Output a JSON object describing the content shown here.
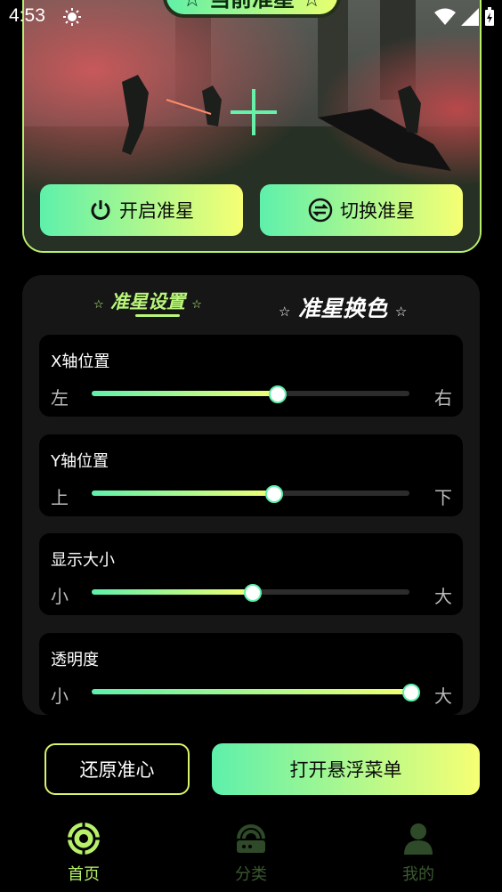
{
  "status_bar": {
    "time": "4:53"
  },
  "hero": {
    "title": "☆ 当前准星 ☆",
    "enable_label": "开启准星",
    "switch_label": "切换准星"
  },
  "settings": {
    "tabs": [
      {
        "label": "准星设置",
        "active": true
      },
      {
        "label": "准星换色",
        "active": false
      }
    ],
    "sliders": [
      {
        "label": "X轴位置",
        "left": "左",
        "right": "右",
        "value_percent": 58
      },
      {
        "label": "Y轴位置",
        "left": "上",
        "right": "下",
        "value_percent": 57
      },
      {
        "label": "显示大小",
        "left": "小",
        "right": "大",
        "value_percent": 50
      },
      {
        "label": "透明度",
        "left": "小",
        "right": "大",
        "value_percent": 100
      }
    ]
  },
  "actions": {
    "reset_label": "还原准心",
    "float_label": "打开悬浮菜单"
  },
  "nav": [
    {
      "label": "首页",
      "icon": "crosshair-target-icon",
      "active": true
    },
    {
      "label": "分类",
      "icon": "router-icon",
      "active": false
    },
    {
      "label": "我的",
      "icon": "user-icon",
      "active": false
    }
  ],
  "colors": {
    "accent_green": "#5ef0ab",
    "accent_yellow": "#f6ff73",
    "card": "#161616"
  }
}
